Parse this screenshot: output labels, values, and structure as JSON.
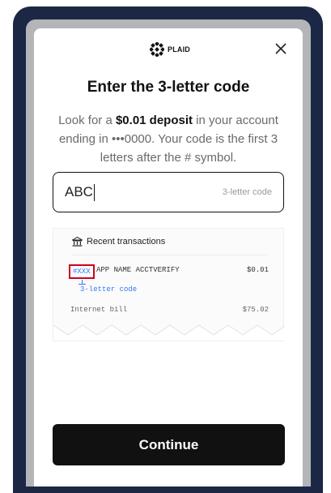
{
  "header": {
    "logo_text": "PLAID",
    "close_icon": "close-icon"
  },
  "title": "Enter the 3-letter code",
  "description": {
    "part1": "Look for a ",
    "emphasis": "$0.01 deposit",
    "part2": " in your account ending in •••0000. Your code is the first 3 letters after the # symbol."
  },
  "code_input": {
    "value": "ABC",
    "hint": "3-letter code"
  },
  "receipt": {
    "heading": "Recent transactions",
    "heading_icon": "bank-icon",
    "transactions": [
      {
        "code": "#XXX",
        "name": "APP NAME ACCTVERIFY",
        "amount": "$0.01"
      },
      {
        "name": "Internet bill",
        "amount": "$75.02"
      }
    ],
    "code_callout": "3-letter code"
  },
  "continue_label": "Continue",
  "colors": {
    "frame": "#1b2745",
    "bezel": "#b3b5b8",
    "highlight": "#d0021b",
    "link_blue": "#3478f6",
    "button": "#111111"
  }
}
